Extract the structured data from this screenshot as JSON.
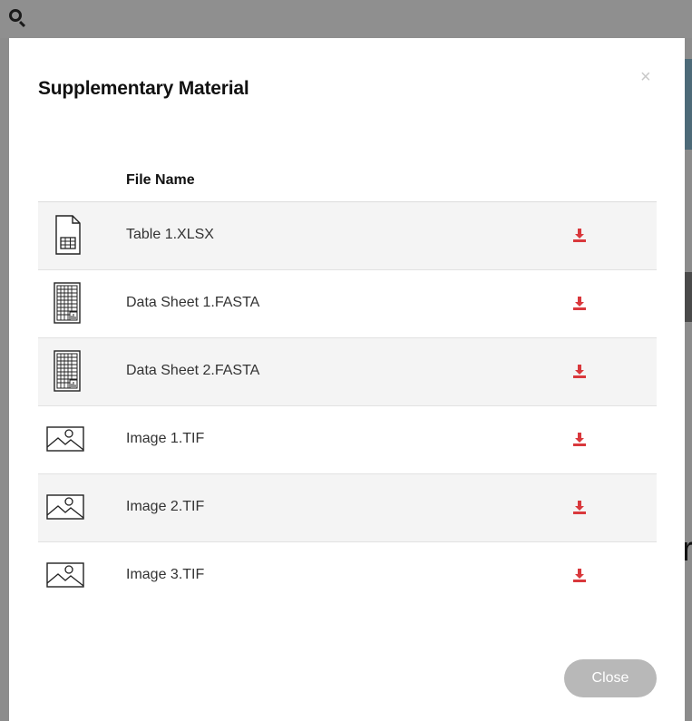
{
  "modal": {
    "title": "Supplementary Material",
    "close_icon": "×",
    "close_button_label": "Close"
  },
  "table": {
    "column_header": "File Name",
    "files": [
      {
        "name": "Table 1.XLSX",
        "icon": "spreadsheet-file-icon"
      },
      {
        "name": "Data Sheet 1.FASTA",
        "icon": "data-sheet-file-icon"
      },
      {
        "name": "Data Sheet 2.FASTA",
        "icon": "data-sheet-file-icon"
      },
      {
        "name": "Image 1.TIF",
        "icon": "image-file-icon"
      },
      {
        "name": "Image 2.TIF",
        "icon": "image-file-icon"
      },
      {
        "name": "Image 3.TIF",
        "icon": "image-file-icon"
      }
    ],
    "download_icon": "download-icon"
  },
  "background": {
    "partial_letter": "r"
  },
  "colors": {
    "download": "#d9383c",
    "close_button": "#b8b8b8",
    "row_stripe": "#f4f4f4"
  }
}
